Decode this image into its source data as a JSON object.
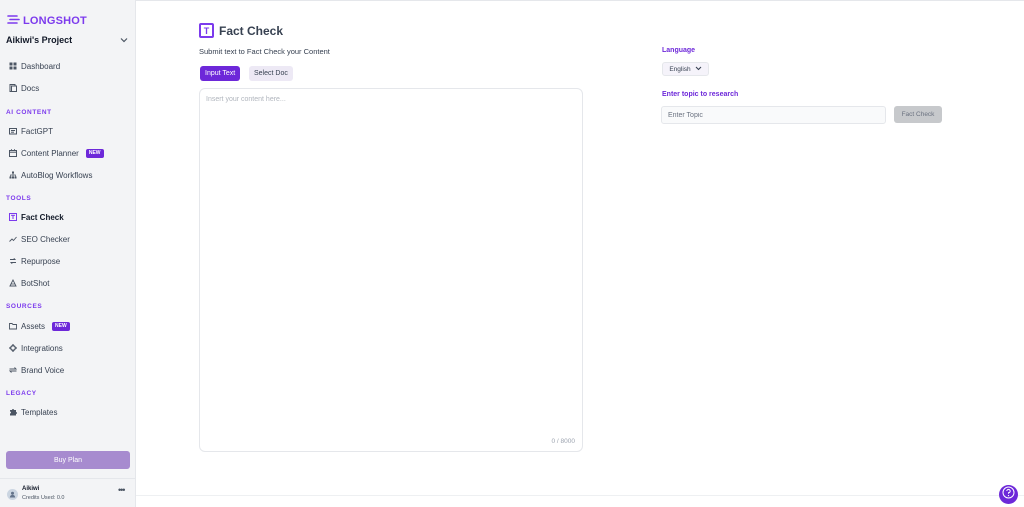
{
  "brand": {
    "name": "LONGSHOT",
    "accent": "#7c3aed"
  },
  "project": {
    "name": "Aikiwi's Project"
  },
  "sidebar": {
    "top_items": [
      {
        "label": "Dashboard",
        "icon": "dashboard-icon"
      },
      {
        "label": "Docs",
        "icon": "docs-icon"
      }
    ],
    "sections": [
      {
        "label": "AI CONTENT",
        "items": [
          {
            "label": "FactGPT",
            "icon": "factgpt-icon"
          },
          {
            "label": "Content Planner",
            "icon": "calendar-icon",
            "badge": "NEW"
          },
          {
            "label": "AutoBlog Workflows",
            "icon": "workflow-icon"
          }
        ]
      },
      {
        "label": "TOOLS",
        "items": [
          {
            "label": "Fact Check",
            "icon": "fact-check-icon",
            "active": true
          },
          {
            "label": "SEO Checker",
            "icon": "trending-icon"
          },
          {
            "label": "Repurpose",
            "icon": "repurpose-icon"
          },
          {
            "label": "BotShot",
            "icon": "bot-icon"
          }
        ]
      },
      {
        "label": "SOURCES",
        "items": [
          {
            "label": "Assets",
            "icon": "folder-icon",
            "badge": "NEW"
          },
          {
            "label": "Integrations",
            "icon": "gear-icon"
          },
          {
            "label": "Brand Voice",
            "icon": "swap-icon"
          }
        ]
      },
      {
        "label": "LEGACY",
        "items": [
          {
            "label": "Templates",
            "icon": "puzzle-icon"
          }
        ]
      }
    ],
    "buy_plan_label": "Buy Plan",
    "user": {
      "name": "Aikiwi",
      "credits": "Credits Used: 0.0"
    }
  },
  "main": {
    "title": "Fact Check",
    "title_icon_glyph": "T",
    "subtitle": "Submit text to Fact Check your Content",
    "tabs": [
      {
        "label": "Input Text",
        "active": true
      },
      {
        "label": "Select Doc",
        "active": false
      }
    ],
    "content_placeholder": "Insert your content here...",
    "char_count": "0 / 8000"
  },
  "settings": {
    "language_label": "Language",
    "language_value": "English",
    "topic_label": "Enter topic to research",
    "topic_placeholder": "Enter Topic",
    "fact_check_button": "Fact Check"
  }
}
